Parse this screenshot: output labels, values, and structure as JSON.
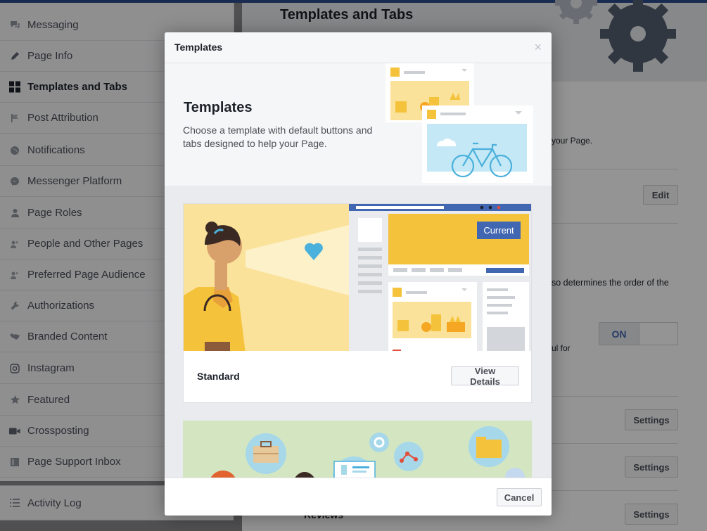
{
  "sidebar": {
    "items": [
      {
        "label": "Messaging",
        "icon": "messaging-icon"
      },
      {
        "label": "Page Info",
        "icon": "pencil-icon"
      },
      {
        "label": "Templates and Tabs",
        "icon": "grid-icon",
        "active": true
      },
      {
        "label": "Post Attribution",
        "icon": "flag-icon"
      },
      {
        "label": "Notifications",
        "icon": "globe-icon"
      },
      {
        "label": "Messenger Platform",
        "icon": "messenger-icon"
      },
      {
        "label": "Page Roles",
        "icon": "person-icon"
      },
      {
        "label": "People and Other Pages",
        "icon": "people-icon"
      },
      {
        "label": "Preferred Page Audience",
        "icon": "audience-icon"
      },
      {
        "label": "Authorizations",
        "icon": "wrench-icon"
      },
      {
        "label": "Branded Content",
        "icon": "handshake-icon"
      },
      {
        "label": "Instagram",
        "icon": "instagram-icon"
      },
      {
        "label": "Featured",
        "icon": "star-icon"
      },
      {
        "label": "Crossposting",
        "icon": "video-camera-icon"
      },
      {
        "label": "Page Support Inbox",
        "icon": "inbox-icon"
      }
    ],
    "activity_log": {
      "label": "Activity Log",
      "icon": "list-icon"
    }
  },
  "main": {
    "title": "Templates and Tabs",
    "text_page": "your Page.",
    "text_order": "so determines the order of the",
    "text_useful": "ul for",
    "edit_label": "Edit",
    "toggle_label": "ON",
    "settings_label": "Settings",
    "reviews_label": "Reviews"
  },
  "modal": {
    "title": "Templates",
    "close_glyph": "×",
    "intro_title": "Templates",
    "intro_desc": "Choose a template with default buttons and tabs designed to help your Page.",
    "templates": [
      {
        "name": "Standard",
        "badge": "Current",
        "view_label": "View Details"
      }
    ],
    "cancel_label": "Cancel"
  },
  "colors": {
    "accent": "#4267b2",
    "illustration_yellow": "#f5c33b",
    "illustration_blue": "#c4e8f5",
    "heart": "#4ab0dc",
    "green_card": "#d3e6c1"
  }
}
